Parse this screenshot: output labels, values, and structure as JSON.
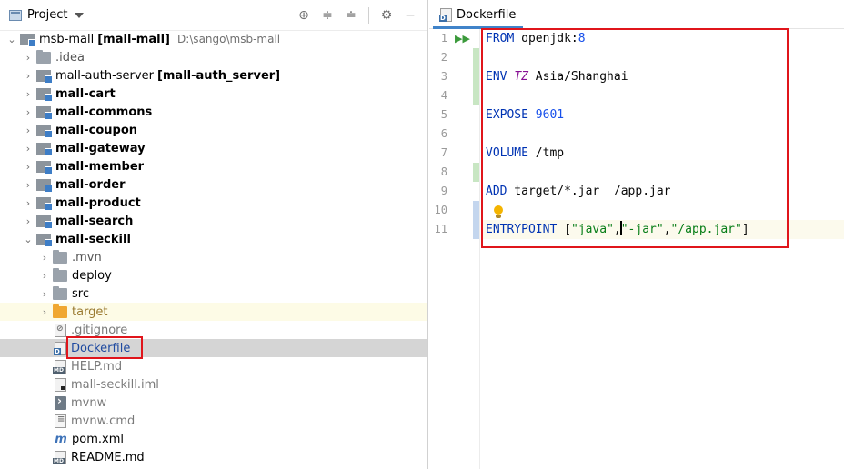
{
  "project_panel": {
    "title": "Project",
    "tools": {
      "locate": "⊕",
      "expand_all": "≑",
      "collapse_all": "≐",
      "settings": "⚙",
      "hide": "−"
    },
    "tree": {
      "root_name": "msb-mall",
      "root_module": "[mall-mall]",
      "root_path": "D:\\sango\\msb-mall",
      "idea": ".idea",
      "auth_server_name": "mall-auth-server",
      "auth_server_module": "[mall-auth_server]",
      "modules": [
        "mall-cart",
        "mall-commons",
        "mall-coupon",
        "mall-gateway",
        "mall-member",
        "mall-order",
        "mall-product",
        "mall-search"
      ],
      "seckill": "mall-seckill",
      "seckill_children": {
        "mvn": ".mvn",
        "deploy": "deploy",
        "src": "src",
        "target": "target",
        "gitignore": ".gitignore",
        "dockerfile": "Dockerfile",
        "help": "HELP.md",
        "iml": "mall-seckill.iml",
        "mvnw": "mvnw",
        "mvnw_cmd": "mvnw.cmd",
        "pom": "pom.xml",
        "readme": "README.md"
      }
    }
  },
  "editor": {
    "tab_label": "Dockerfile",
    "line_numbers": [
      "1",
      "2",
      "3",
      "4",
      "5",
      "6",
      "7",
      "8",
      "9",
      "10",
      "11"
    ],
    "code": {
      "l1_kw": "FROM",
      "l1_rest": " openjdk:",
      "l1_num": "8",
      "l3_kw": "ENV",
      "l3_var": "TZ",
      "l3_rest": " Asia/Shanghai",
      "l5_kw": "EXPOSE",
      "l5_num": "9601",
      "l7_kw": "VOLUME",
      "l7_rest": " /tmp",
      "l9_kw": "ADD",
      "l9_rest": " target/*.jar  /app.jar",
      "l11_kw": "ENTRYPOINT",
      "l11_open": " [",
      "l11_s1": "\"java\"",
      "l11_comma1": ",",
      "l11_s2": "\"-jar\"",
      "l11_comma2": ",",
      "l11_s3": "\"/app.jar\"",
      "l11_close": "]"
    }
  },
  "colors": {
    "keyword": "#0033b3",
    "number": "#1750eb",
    "variable": "#871094",
    "string": "#067d17",
    "highlight_box": "#e0151b",
    "selection": "#d5d5d5"
  }
}
